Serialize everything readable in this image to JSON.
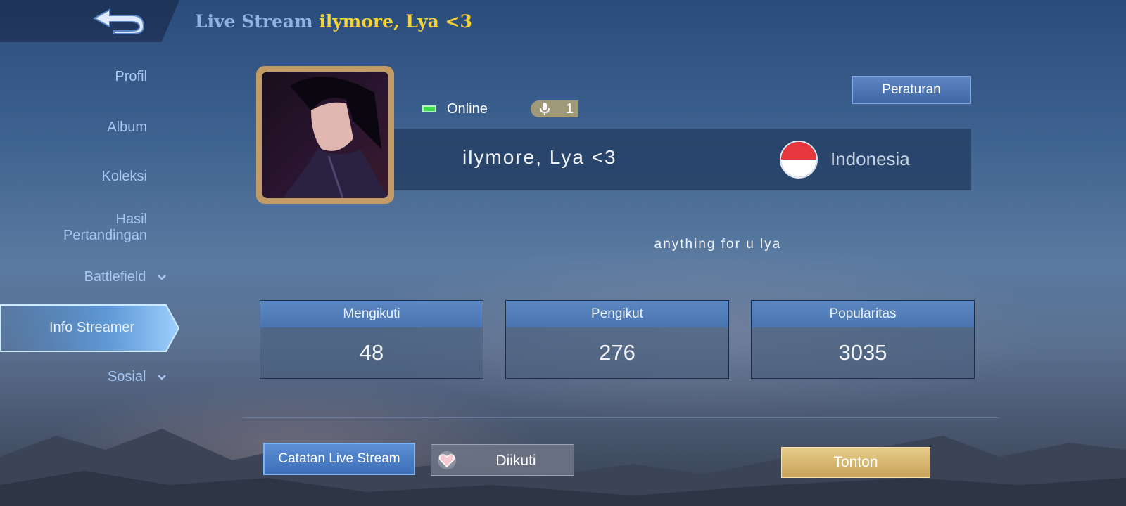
{
  "header": {
    "title_prefix": "Live Stream",
    "title_name": "ilymore, Lya <3"
  },
  "sidebar": {
    "items": [
      {
        "label": "Profil"
      },
      {
        "label": "Album"
      },
      {
        "label": "Koleksi"
      },
      {
        "label": "Hasil"
      },
      {
        "label": "Pertandingan"
      },
      {
        "label": "Battlefield"
      },
      {
        "label": "Info Streamer"
      },
      {
        "label": "Sosial"
      }
    ]
  },
  "profile": {
    "status": "Online",
    "mic_count": "1",
    "rules_label": "Peraturan",
    "name": "ilymore, Lya <3",
    "country": "Indonesia",
    "bio": "anything for u lya"
  },
  "stats": [
    {
      "label": "Mengikuti",
      "value": "48"
    },
    {
      "label": "Pengikut",
      "value": "276"
    },
    {
      "label": "Popularitas",
      "value": "3035"
    }
  ],
  "actions": {
    "log_label": "Catatan Live Stream",
    "follow_label": "Diikuti",
    "watch_label": "Tonton"
  },
  "colors": {
    "title_name": "#f4d23a",
    "online": "#3ddc4e",
    "accent": "#4a74b0",
    "gold": "#c9a35a"
  }
}
